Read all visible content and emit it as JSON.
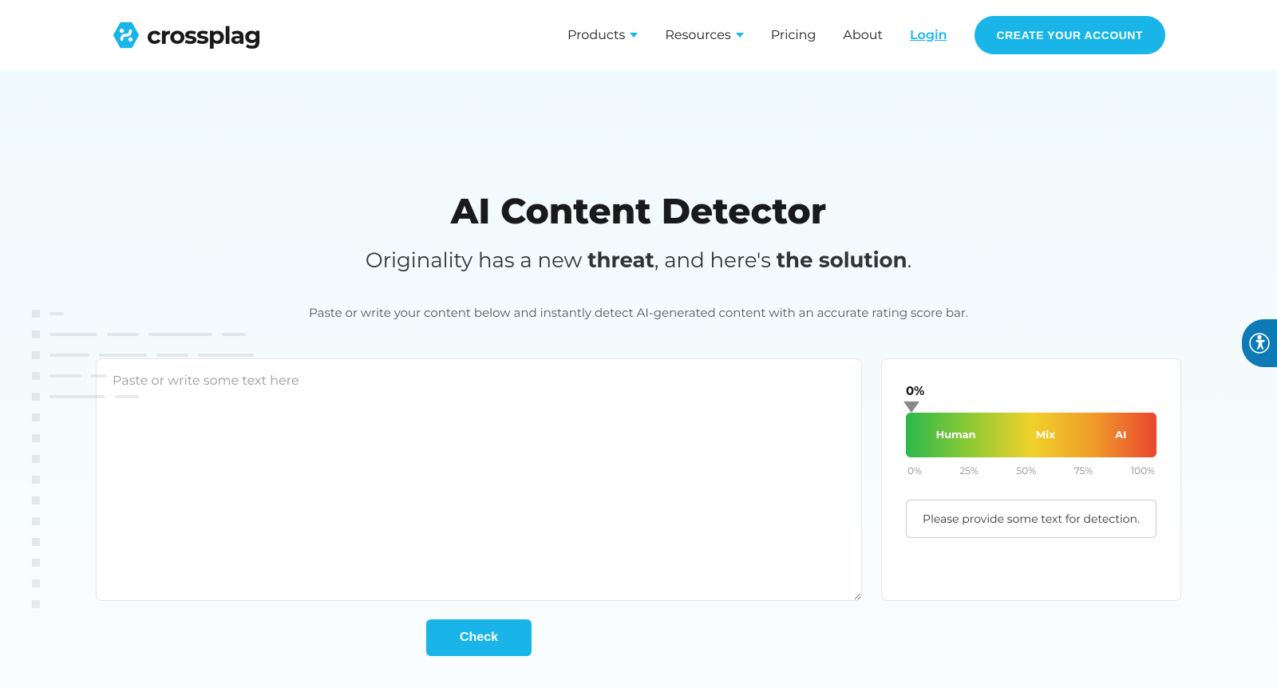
{
  "brand": {
    "name": "crossplag"
  },
  "nav": {
    "products": "Products",
    "resources": "Resources",
    "pricing": "Pricing",
    "about": "About",
    "login": "Login",
    "cta": "CREATE YOUR ACCOUNT"
  },
  "hero": {
    "title": "AI Content Detector",
    "subtitle_pre": "Originality has a new ",
    "subtitle_bold1": "threat",
    "subtitle_mid": ", and here's ",
    "subtitle_bold2": "the solution",
    "subtitle_end": ".",
    "instruction": "Paste or write your content below and instantly detect AI-generated content with an accurate rating score bar."
  },
  "editor": {
    "placeholder": "Paste or write some text here",
    "check_label": "Check"
  },
  "score": {
    "current": "0%",
    "labels": {
      "human": "Human",
      "mix": "Mix",
      "ai": "AI"
    },
    "ticks": [
      "0%",
      "25%",
      "50%",
      "75%",
      "100%"
    ],
    "message": "Please provide some text for detection."
  }
}
